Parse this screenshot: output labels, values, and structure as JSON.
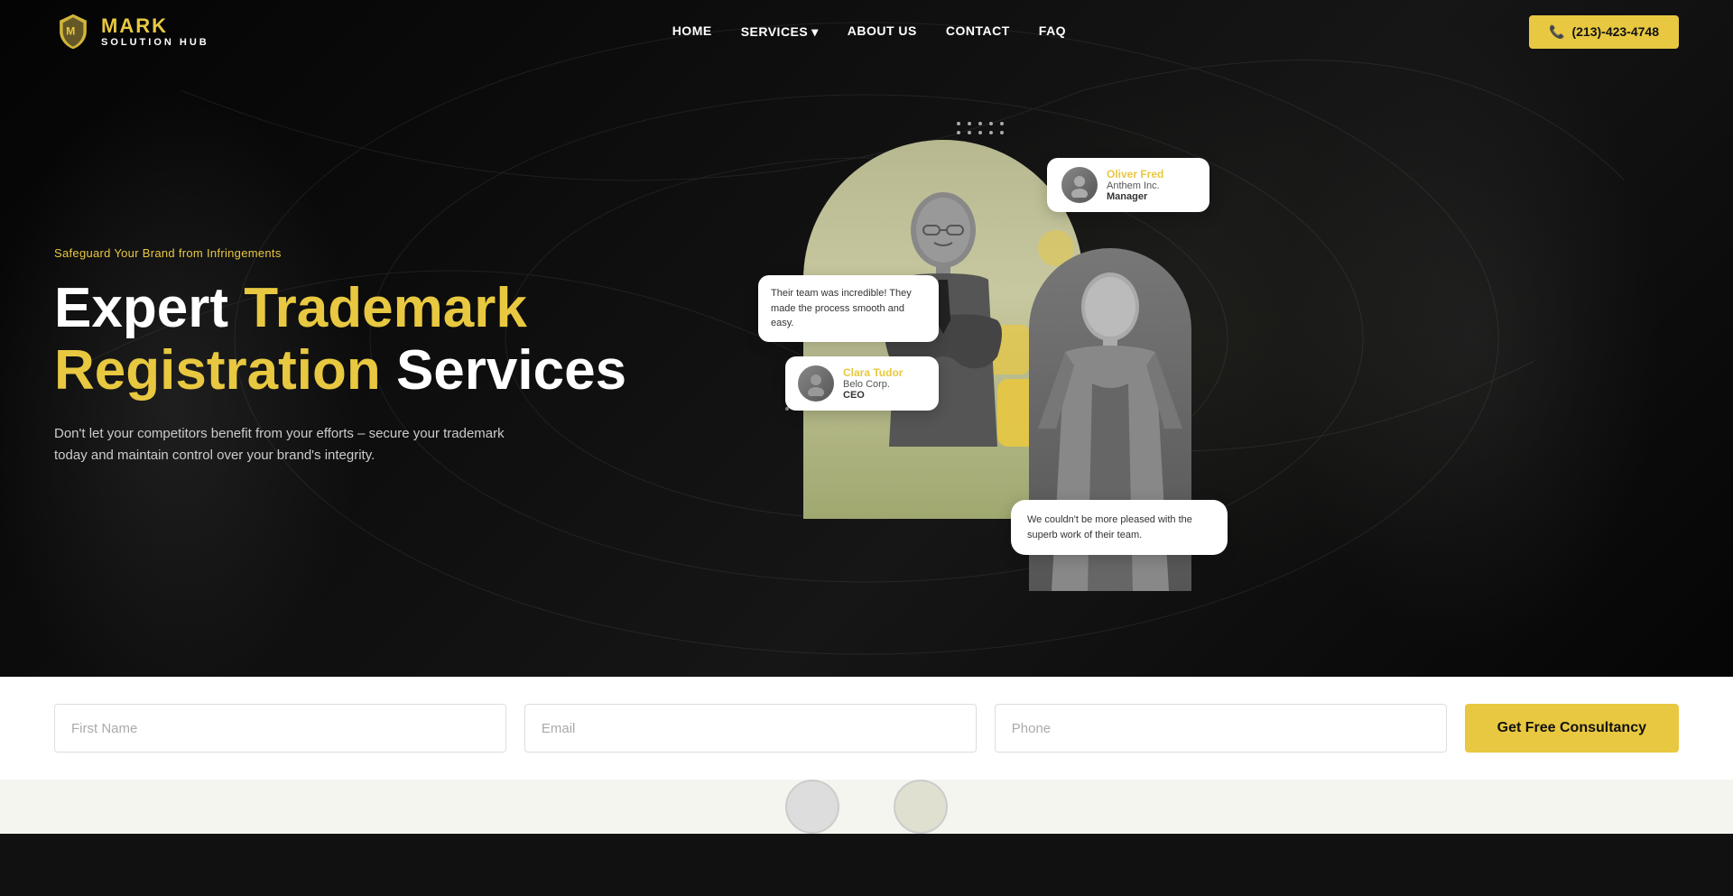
{
  "brand": {
    "name_mark": "MARK",
    "name_sub": "SOLUTION HUB"
  },
  "nav": {
    "links": [
      {
        "id": "home",
        "label": "HOME"
      },
      {
        "id": "services",
        "label": "SERVICES",
        "has_dropdown": true
      },
      {
        "id": "about",
        "label": "ABOUT US"
      },
      {
        "id": "contact",
        "label": "CONTACT"
      },
      {
        "id": "faq",
        "label": "FAQ"
      }
    ],
    "phone": "(213)-423-4748"
  },
  "hero": {
    "tagline": "Safeguard Your Brand from Infringements",
    "title_part1": "Expert ",
    "title_highlight": "Trademark",
    "title_part2": "Registration",
    "title_part3": " Services",
    "description": "Don't let your competitors benefit from your efforts – secure your trademark today and maintain control over your brand's integrity."
  },
  "testimonials": {
    "profile1": {
      "name": "Oliver Fred",
      "company": "Anthem Inc.",
      "role": "Manager"
    },
    "bubble1": "Their team was incredible! They made the process smooth and easy.",
    "profile2": {
      "name": "Clara Tudor",
      "company": "Belo Corp.",
      "role": "CEO"
    },
    "bubble2": "We couldn't be more pleased with the superb work of their team."
  },
  "form": {
    "first_name_placeholder": "First Name",
    "email_placeholder": "Email",
    "phone_placeholder": "Phone",
    "cta_label": "Get Free Consultancy"
  },
  "icons": {
    "phone": "📞",
    "chevron_down": "▾"
  }
}
